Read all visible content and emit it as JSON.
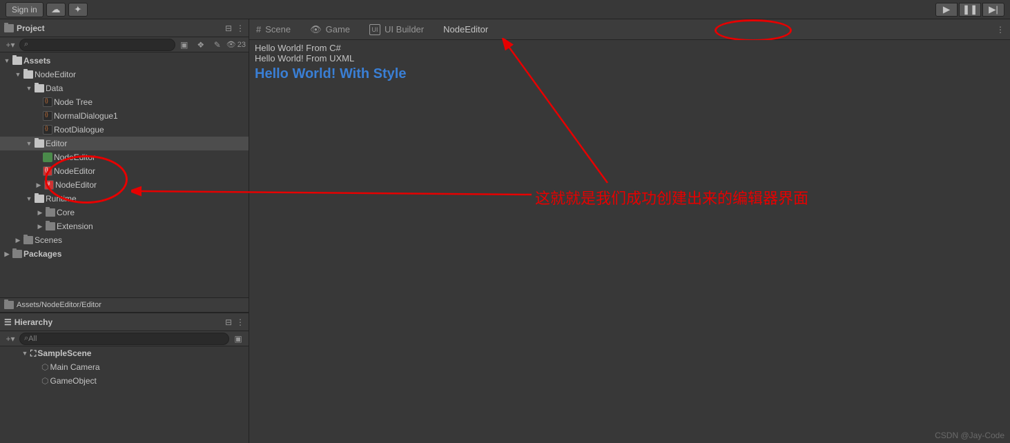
{
  "topbar": {
    "sign_in": "Sign in"
  },
  "project": {
    "title": "Project",
    "hidden_count": "23",
    "search_placeholder": "",
    "path": "Assets/NodeEditor/Editor",
    "tree": {
      "assets": "Assets",
      "nodeeditor": "NodeEditor",
      "data": "Data",
      "nodetree": "Node Tree",
      "normaldialogue": "NormalDialogue1",
      "rootdialogue": "RootDialogue",
      "editor": "Editor",
      "nodeeditor_cs": "NodeEditor",
      "nodeeditor_uxml": "NodeEditor",
      "nodeeditor_uss": "NodeEditor",
      "runtime": "Runtime",
      "core": "Core",
      "extension": "Extension",
      "scenes": "Scenes",
      "packages": "Packages"
    }
  },
  "hierarchy": {
    "title": "Hierarchy",
    "search_placeholder": "All",
    "scene": "SampleScene",
    "camera": "Main Camera",
    "gameobject": "GameObject"
  },
  "tabs": {
    "scene": "Scene",
    "game": "Game",
    "uibuilder": "UI Builder",
    "nodeeditor": "NodeEditor"
  },
  "content": {
    "line1": "Hello World! From C#",
    "line2": "Hello World! From UXML",
    "line3": "Hello World! With Style"
  },
  "annotation": {
    "text": "这就就是我们成功创建出来的编辑器界面"
  },
  "watermark": "CSDN @Jay-Code"
}
